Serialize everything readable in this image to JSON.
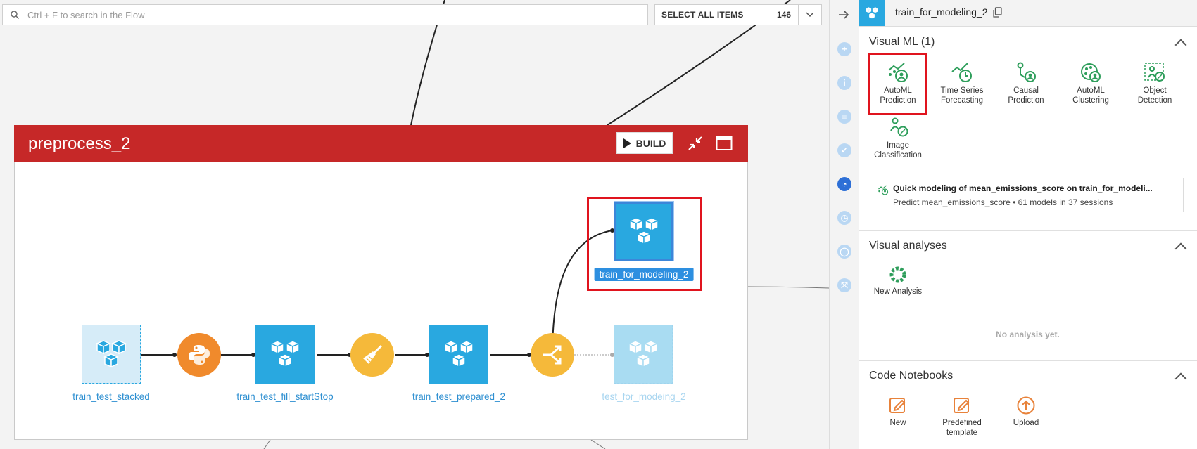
{
  "search": {
    "placeholder": "Ctrl + F to search in the Flow"
  },
  "selection": {
    "label": "SELECT ALL ITEMS",
    "count": "146"
  },
  "zone": {
    "title": "preprocess_2",
    "build_label": "BUILD",
    "colors": {
      "header": "#c62828"
    }
  },
  "flow": {
    "datasets": [
      {
        "label": "train_test_stacked"
      },
      {
        "label": "train_test_fill_startStop"
      },
      {
        "label": "train_test_prepared_2"
      },
      {
        "label": "test_for_modeing_2"
      },
      {
        "label": "train_for_modeling_2"
      }
    ],
    "recipes": [
      {
        "kind": "python",
        "icon": "python-icon",
        "color": "#f08a2c"
      },
      {
        "kind": "prepare",
        "icon": "broom-icon",
        "color": "#f5b93a"
      },
      {
        "kind": "split",
        "icon": "split-icon",
        "color": "#f5b93a"
      }
    ]
  },
  "panel": {
    "title": "train_for_modeling_2",
    "visual_ml": {
      "title": "Visual ML (1)",
      "tools": [
        {
          "line1": "AutoML",
          "line2": "Prediction"
        },
        {
          "line1": "Time Series",
          "line2": "Forecasting"
        },
        {
          "line1": "Causal",
          "line2": "Prediction"
        },
        {
          "line1": "AutoML",
          "line2": "Clustering"
        },
        {
          "line1": "Object",
          "line2": "Detection"
        },
        {
          "line1": "Image",
          "line2": "Classification"
        }
      ],
      "quick_model": {
        "title": "Quick modeling of mean_emissions_score on train_for_modeli...",
        "subtitle": "Predict mean_emissions_score • 61 models in 37 sessions"
      }
    },
    "visual_analyses": {
      "title": "Visual analyses",
      "new_label": "New Analysis",
      "empty": "No analysis yet."
    },
    "code_notebooks": {
      "title": "Code Notebooks",
      "items": [
        {
          "line1": "New",
          "line2": ""
        },
        {
          "line1": "Predefined",
          "line2": "template"
        },
        {
          "line1": "Upload",
          "line2": ""
        }
      ]
    }
  },
  "colors": {
    "dataset": "#29a8e0",
    "ml_green": "#2e9e5b",
    "notebook_orange": "#e8823a",
    "highlight": "#e0141e"
  }
}
